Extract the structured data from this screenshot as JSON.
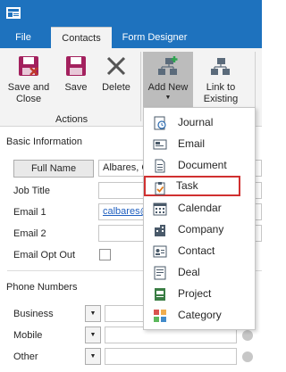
{
  "ribbon": {
    "tabs": [
      {
        "label": "File"
      },
      {
        "label": "Contacts"
      },
      {
        "label": "Form Designer"
      }
    ],
    "save_close_label": "Save and\nClose",
    "save_label": "Save",
    "delete_label": "Delete",
    "add_new_label": "Add New",
    "link_existing_label": "Link to\nExisting",
    "actions_group_label": "Actions"
  },
  "form": {
    "basic_info_title": "Basic Information",
    "full_name_button": "Full Name",
    "full_name_value": "Albares, C",
    "job_title_label": "Job Title",
    "email1_label": "Email 1",
    "email1_value": "calbares@",
    "email2_label": "Email 2",
    "email_opt_out_label": "Email Opt Out",
    "phone_numbers_title": "Phone Numbers",
    "business_label": "Business",
    "mobile_label": "Mobile",
    "other_label": "Other"
  },
  "menu": {
    "items": [
      {
        "label": "Journal",
        "icon": "journal-icon"
      },
      {
        "label": "Email",
        "icon": "email-icon"
      },
      {
        "label": "Document",
        "icon": "document-icon"
      },
      {
        "label": "Task",
        "icon": "task-icon",
        "highlighted": true
      },
      {
        "label": "Calendar",
        "icon": "calendar-icon"
      },
      {
        "label": "Company",
        "icon": "company-icon"
      },
      {
        "label": "Contact",
        "icon": "contact-icon"
      },
      {
        "label": "Deal",
        "icon": "deal-icon"
      },
      {
        "label": "Project",
        "icon": "project-icon"
      },
      {
        "label": "Category",
        "icon": "category-icon"
      }
    ]
  },
  "colors": {
    "title_bar": "#1e72be",
    "ribbon_bg": "#f3f3f3",
    "highlight_border": "#d03030",
    "save_icon": "#a3215e",
    "link": "#1f5fbf"
  }
}
